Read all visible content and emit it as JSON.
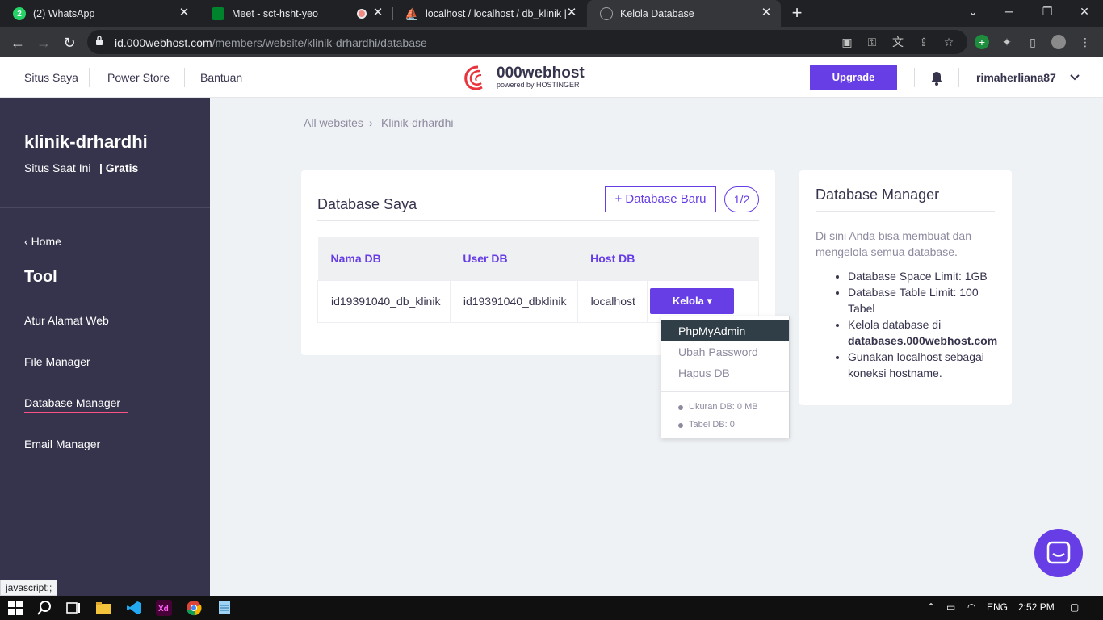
{
  "browser": {
    "tabs": [
      {
        "title": "(2) WhatsApp",
        "icon": "whatsapp-icon"
      },
      {
        "title": "Meet - sct-hsht-yeo",
        "icon": "google-meet-icon"
      },
      {
        "title": "localhost / localhost / db_klinik |",
        "icon": "phpmyadmin-icon"
      },
      {
        "title": "Kelola Database",
        "icon": "globe-icon",
        "active": true
      }
    ],
    "url_host": "id.000webhost.com",
    "url_path": "/members/website/klinik-drhardhi/database"
  },
  "header": {
    "nav": [
      "Situs Saya",
      "Power Store",
      "Bantuan"
    ],
    "logo_brand": "000webhost",
    "logo_sub": "powered by HOSTINGER",
    "upgrade_label": "Upgrade",
    "username": "rimaherliana87"
  },
  "sidebar": {
    "site_name": "klinik-drhardhi",
    "site_status": "Situs Saat Ini",
    "site_plan": "| Gratis",
    "home_label": "Home",
    "section_title": "Tool",
    "items": [
      "Atur Alamat Web",
      "File Manager",
      "Database Manager",
      "Email Manager"
    ],
    "active_item": "Database Manager"
  },
  "breadcrumb": {
    "root": "All websites",
    "separator": "›",
    "current": "Klinik-drhardhi"
  },
  "database_card": {
    "title": "Database Saya",
    "new_db_label": "+ Database Baru",
    "count": "1/2",
    "columns": [
      "Nama DB",
      "User DB",
      "Host DB"
    ],
    "rows": [
      {
        "name": "id19391040_db_klinik",
        "user": "id19391040_dbklinik",
        "host": "localhost",
        "action": "Kelola"
      }
    ]
  },
  "dropdown": {
    "items": [
      "PhpMyAdmin",
      "Ubah Password",
      "Hapus DB"
    ],
    "highlighted": "PhpMyAdmin",
    "stats": [
      "Ukuran DB: 0 MB",
      "Tabel DB: 0"
    ]
  },
  "info_card": {
    "title": "Database Manager",
    "intro": "Di sini Anda bisa membuat dan mengelola semua database.",
    "bullets": [
      "Database Space Limit: 1GB",
      "Database Table Limit: 100 Tabel",
      "Kelola database di",
      "Gunakan localhost sebagai koneksi hostname."
    ],
    "bullet3_bold": "databases.000webhost.com"
  },
  "statusbar": {
    "text": "javascript:;"
  },
  "taskbar": {
    "lang": "ENG",
    "time": "2:52 PM"
  },
  "colors": {
    "accent": "#673de6",
    "sidebar": "#36344d",
    "active_underline": "#fc5185",
    "dropdown_highlight": "#2f3e47"
  }
}
